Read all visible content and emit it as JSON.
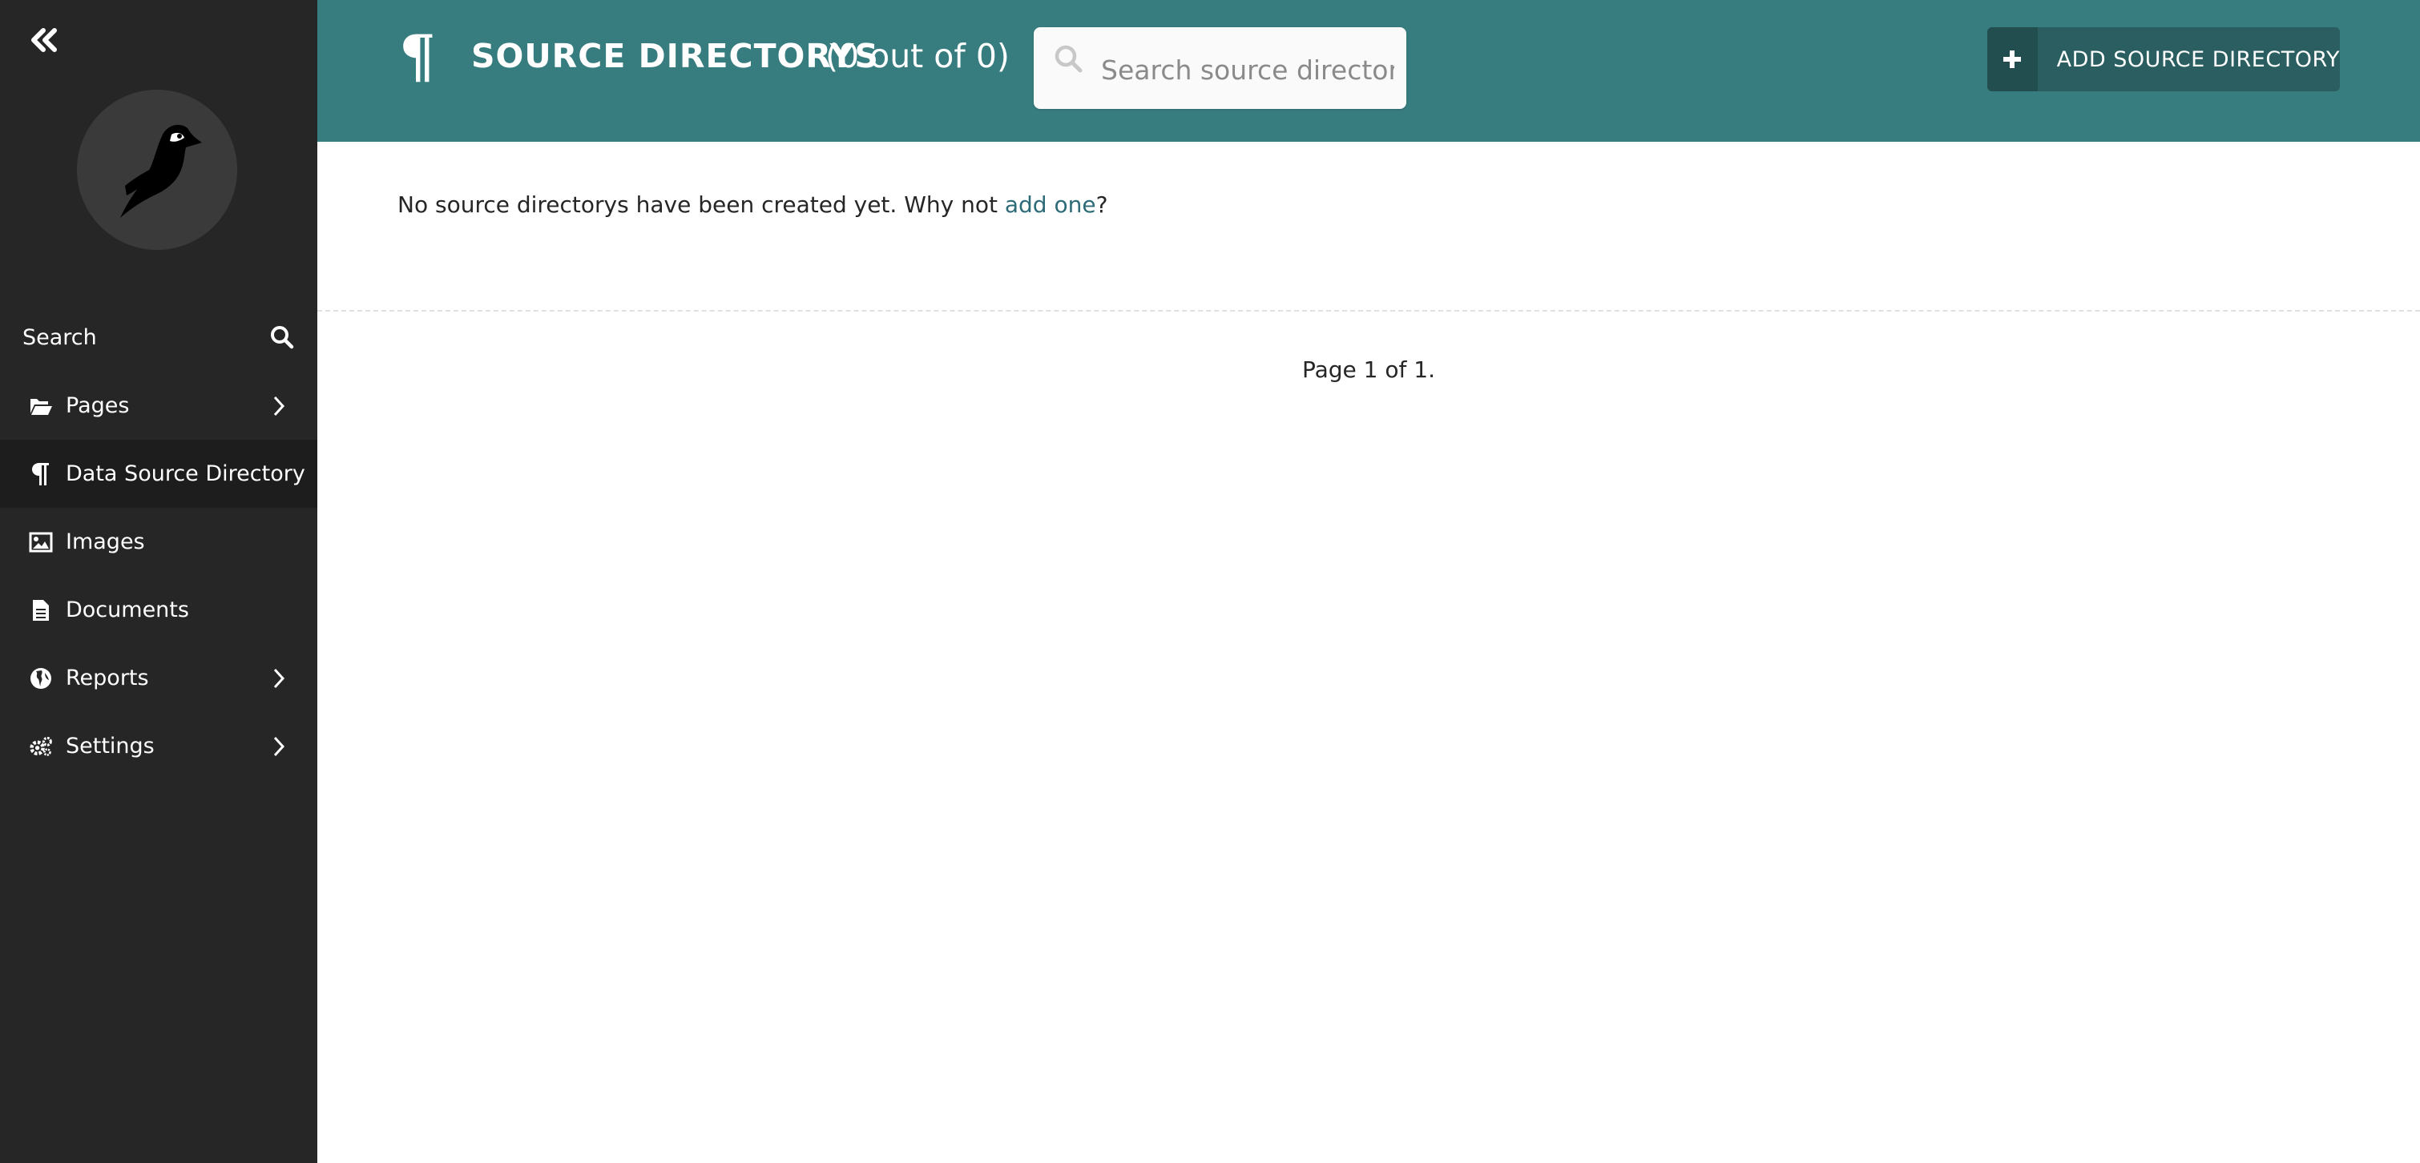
{
  "sidebar": {
    "collapse_icon": "double-chevron-left-icon",
    "logo": "bird-logo",
    "search_label": "Search",
    "items": [
      {
        "label": "Pages",
        "icon": "folder-open-icon",
        "has_submenu": true
      },
      {
        "label": "Data Source Directory",
        "icon": "pilcrow-icon",
        "active": true
      },
      {
        "label": "Images",
        "icon": "image-icon"
      },
      {
        "label": "Documents",
        "icon": "document-icon"
      },
      {
        "label": "Reports",
        "icon": "globe-icon",
        "has_submenu": true
      },
      {
        "label": "Settings",
        "icon": "cogs-icon",
        "has_submenu": true
      }
    ]
  },
  "header": {
    "title": "SOURCE DIRECTORYS",
    "count": "(0 out of 0)",
    "search_placeholder": "Search source directory",
    "search_value": "",
    "add_button_label": "ADD SOURCE DIRECTORY"
  },
  "main": {
    "empty_prefix": "No source directorys have been created yet. Why not ",
    "empty_link": "add one",
    "empty_suffix": "?",
    "pagination": "Page 1 of 1."
  },
  "colors": {
    "header_bg": "#377c7e",
    "sidebar_bg": "#262626",
    "sidebar_active_bg": "#1d1d1d",
    "link": "#2e6b78",
    "button_bg": "#2a5e60"
  }
}
